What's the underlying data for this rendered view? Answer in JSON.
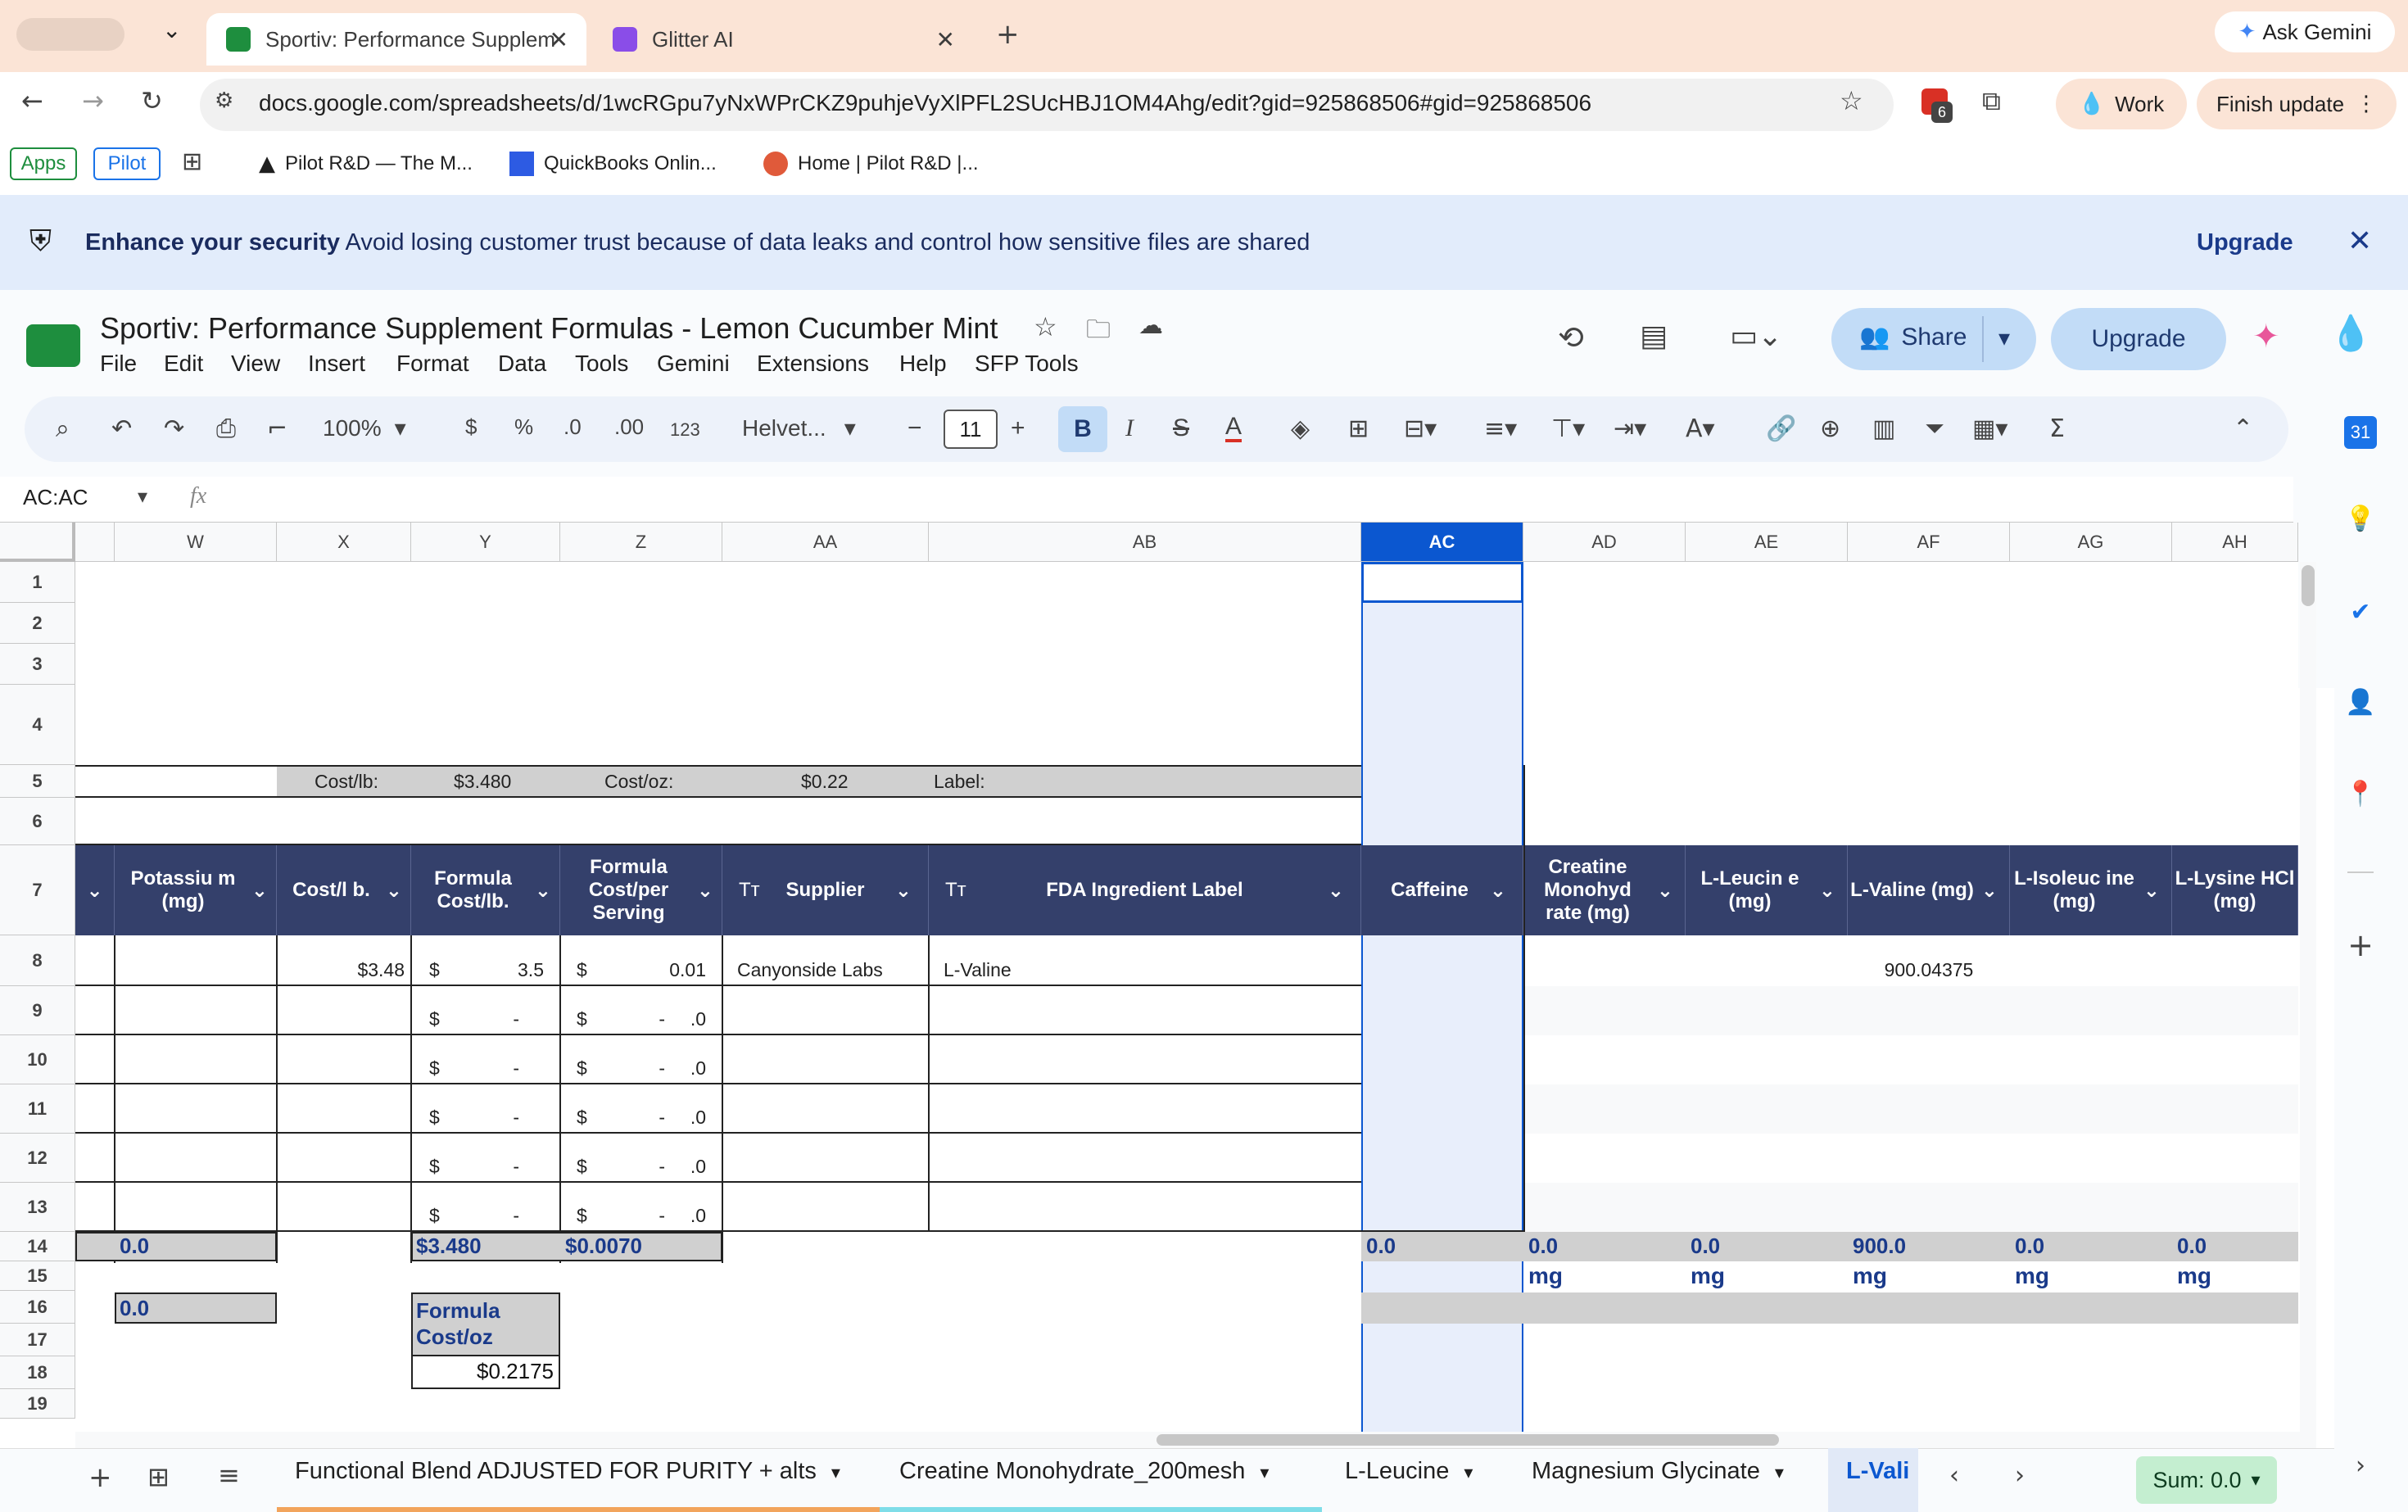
{
  "browser": {
    "tabs": [
      {
        "title": "Sportiv: Performance Supplem"
      },
      {
        "title": "Glitter AI"
      }
    ],
    "ask_gemini": "Ask Gemini",
    "url": "docs.google.com/spreadsheets/d/1wcRGpu7yNxWPrCKZ9puhjeVyXlPFL2SUcHBJ1OM4Ahg/edit?gid=925868506#gid=925868506",
    "ext_badge": "6",
    "profile": "Work",
    "finish_update": "Finish update",
    "bookmarks": [
      "Apps",
      "Pilot",
      "Pilot R&D — The M...",
      "QuickBooks Onlin...",
      "Home | Pilot R&D |..."
    ]
  },
  "banner": {
    "bold": "Enhance your security",
    "text": "Avoid losing customer trust because of data leaks and control how sensitive files are shared",
    "upgrade": "Upgrade"
  },
  "doc": {
    "title": "Sportiv: Performance Supplement Formulas - Lemon Cucumber Mint",
    "menus": [
      "File",
      "Edit",
      "View",
      "Insert",
      "Format",
      "Data",
      "Tools",
      "Gemini",
      "Extensions",
      "Help",
      "SFP Tools"
    ],
    "share": "Share",
    "upgrade": "Upgrade"
  },
  "toolbar": {
    "zoom": "100%",
    "currency": "$",
    "percent": "%",
    "dec_dec": ".0",
    "dec_inc": ".00",
    "numfmt": "123",
    "font": "Helvet...",
    "font_size": "11",
    "minus": "−",
    "plus": "+"
  },
  "formula_bar": {
    "name_box": "AC:AC",
    "fx": "fx"
  },
  "columns": [
    "W",
    "X",
    "Y",
    "Z",
    "AA",
    "AB",
    "AC",
    "AD",
    "AE",
    "AF",
    "AG",
    "AH"
  ],
  "rows": [
    "1",
    "2",
    "3",
    "4",
    "5",
    "6",
    "7",
    "8",
    "9",
    "10",
    "11",
    "12",
    "13",
    "14",
    "15",
    "16",
    "17",
    "18",
    "19"
  ],
  "row5": {
    "cost_lb_label": "Cost/lb:",
    "cost_lb": "$3.480",
    "cost_oz_label": "Cost/oz:",
    "cost_oz": "$0.22",
    "label_label": "Label:"
  },
  "headers": {
    "w": "Potassiu m (mg)",
    "x": "Cost/l b.",
    "y": "Formula Cost/lb.",
    "z": "Formula Cost/per Serving",
    "aa": "Supplier",
    "ab": "FDA Ingredient Label",
    "ac": "Caffeine",
    "ad": "Creatine Monohyd rate (mg)",
    "ae": "L-Leucin e (mg)",
    "af": "L-Valine (mg)",
    "ag": "L-Isoleuc ine (mg)",
    "ah": "L-Lysine HCl (mg)",
    "tt": "Tт"
  },
  "row8": {
    "x": "$3.48",
    "y_sym": "$",
    "y": "3.5",
    "z_sym": "$",
    "z": "0.01",
    "aa": "Canyonside Labs",
    "ab": "L-Valine",
    "af": "900.04375"
  },
  "empty_rows": {
    "sym": "$",
    "dash": "-",
    "z_val": ".0"
  },
  "totals": {
    "w": "0.0",
    "y": "$3.480",
    "z": "$0.0070",
    "ac": "0.0",
    "ad": "0.0",
    "ae": "0.0",
    "af": "900.0",
    "ag": "0.0",
    "ah": "0.0",
    "unit": "mg"
  },
  "row16": {
    "w": "0.0",
    "formula_label": "Formula Cost/oz",
    "formula_value": "$0.2175"
  },
  "sheets": [
    "Functional Blend ADJUSTED FOR PURITY + alts",
    "Creatine Monohydrate_200mesh",
    "L-Leucine",
    "Magnesium Glycinate",
    "L-Vali"
  ],
  "sum": "Sum: 0.0"
}
